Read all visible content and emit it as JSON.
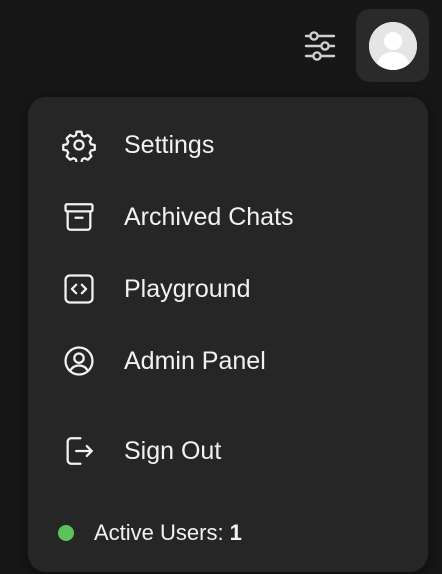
{
  "header": {
    "controls_icon": "sliders-icon",
    "avatar_icon": "user-avatar-icon"
  },
  "menu": {
    "items": [
      {
        "label": "Settings",
        "icon": "gear-icon"
      },
      {
        "label": "Archived Chats",
        "icon": "archive-box-icon"
      },
      {
        "label": "Playground",
        "icon": "code-brackets-icon"
      },
      {
        "label": "Admin Panel",
        "icon": "user-circle-icon"
      },
      {
        "label": "Sign Out",
        "icon": "sign-out-icon"
      }
    ]
  },
  "status": {
    "label": "Active Users:",
    "count": "1",
    "dot_color": "#5cc35c"
  },
  "colors": {
    "background": "#171717",
    "menu_background": "#262626",
    "text": "#f2f2f2"
  }
}
